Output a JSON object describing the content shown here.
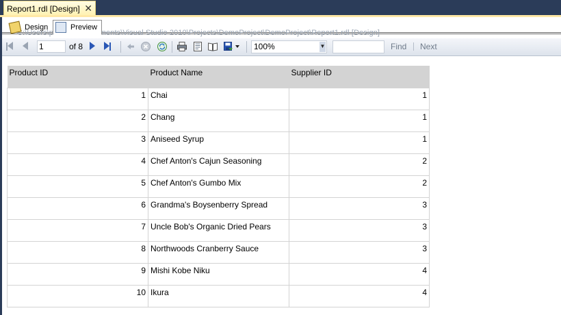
{
  "document_tab": {
    "label": "Report1.rdl [Design]",
    "close_glyph": "✕"
  },
  "view_tabs": {
    "design": "Design",
    "preview": "Preview"
  },
  "path_text": "C:\\Users\\prdmart3\\Documents\\Visual Studio 2010\\Projects\\DemoProject\\DemoProject\\Report1.rdl [Design]",
  "toolbar": {
    "page_value": "1",
    "of_label": "of",
    "total_pages": "8",
    "zoom_value": "100%",
    "find_value": "",
    "find_label": "Find",
    "next_label": "Next"
  },
  "icons": [
    "first-page-icon",
    "previous-page-icon",
    "next-page-icon",
    "last-page-icon",
    "back-icon",
    "stop-icon",
    "refresh-icon",
    "print-icon",
    "print-layout-icon",
    "page-setup-icon",
    "export-icon"
  ],
  "table": {
    "headers": [
      "Product ID",
      "Product Name",
      "Supplier ID"
    ],
    "rows": [
      [
        "1",
        "Chai",
        "1"
      ],
      [
        "2",
        "Chang",
        "1"
      ],
      [
        "3",
        "Aniseed Syrup",
        "1"
      ],
      [
        "4",
        "Chef Anton's Cajun Seasoning",
        "2"
      ],
      [
        "5",
        "Chef Anton's Gumbo Mix",
        "2"
      ],
      [
        "6",
        "Grandma's Boysenberry Spread",
        "3"
      ],
      [
        "7",
        "Uncle Bob's Organic Dried Pears",
        "3"
      ],
      [
        "8",
        "Northwoods Cranberry Sauce",
        "3"
      ],
      [
        "9",
        "Mishi Kobe Niku",
        "4"
      ],
      [
        "10",
        "Ikura",
        "4"
      ]
    ]
  },
  "colors": {
    "frame_navy": "#2b3c59",
    "tab_yellow": "#fff1b0",
    "header_gray": "#d3d3d3",
    "toolbar_blue": "#2a57b5"
  }
}
